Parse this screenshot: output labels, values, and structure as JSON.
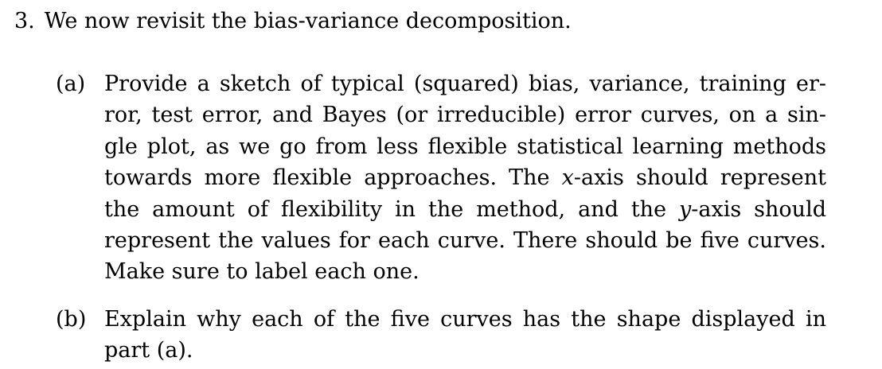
{
  "question": {
    "number": "3.",
    "text": "We now revisit the bias-variance decomposition."
  },
  "part_a": {
    "marker": "(a)",
    "lines": [
      "Provide a sketch of typical (squared) bias, variance, training er-",
      "ror, test error, and Bayes (or irreducible) error curves, on a sin-",
      "gle plot, as we go from less flexible statistical learning methods"
    ],
    "line4_before": "towards more flexible approaches. The ",
    "line4_math": "x",
    "line4_after": "-axis should represent",
    "line5_before": "the amount of flexibility in the method, and the ",
    "line5_math": "y",
    "line5_after": "-axis should",
    "line6": "represent the values for each curve. There should be five curves.",
    "line7": "Make sure to label each one."
  },
  "part_b": {
    "marker": "(b)",
    "line1": "Explain why each of the five curves has the shape displayed in",
    "line2": "part (a)."
  }
}
